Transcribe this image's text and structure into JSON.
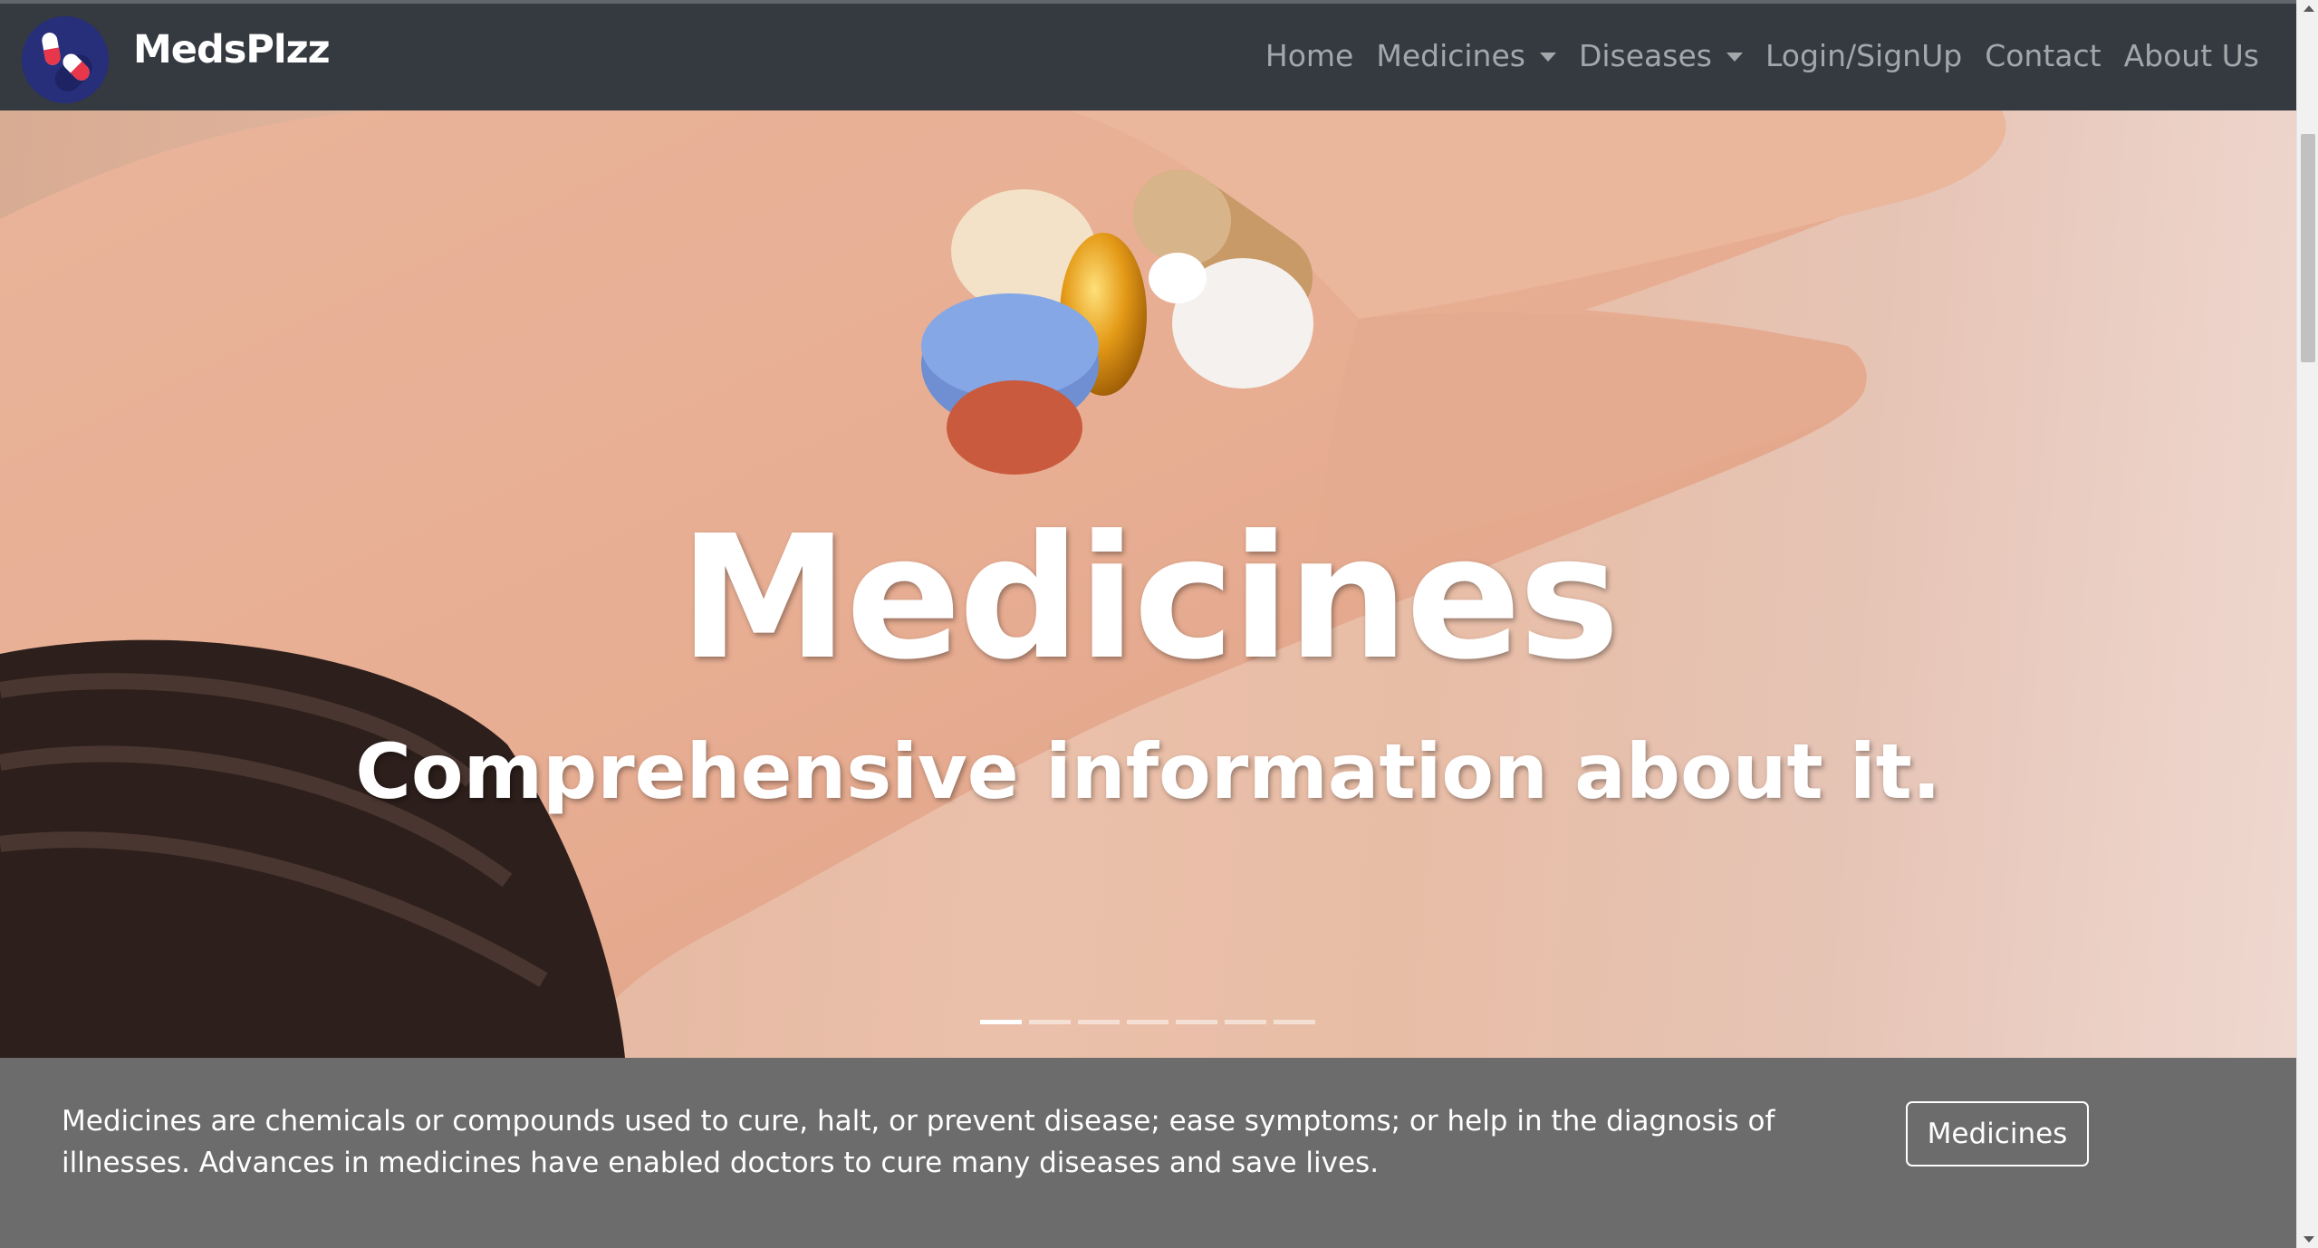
{
  "brand": {
    "name": "MedsPlzz",
    "logo_icon": "pills-logo-icon",
    "logo_bg": "#272e7a"
  },
  "nav": {
    "home": "Home",
    "medicines": "Medicines",
    "diseases": "Diseases",
    "login": "Login/SignUp",
    "contact": "Contact",
    "about": "About Us"
  },
  "hero": {
    "title": "Medicines",
    "subtitle": "Comprehensive information about it.",
    "slide_count": 7,
    "active_slide": 1
  },
  "info": {
    "text": "Medicines are chemicals or compounds used to cure, halt, or prevent disease; ease symptoms; or help in the diagnosis of illnesses. Advances in medicines have enabled doctors to cure many diseases and save lives.",
    "button_label": "Medicines"
  },
  "colors": {
    "navbar_bg": "#343a40",
    "nav_link": "#a4a7aa",
    "info_bg": "#6c6c6c"
  }
}
